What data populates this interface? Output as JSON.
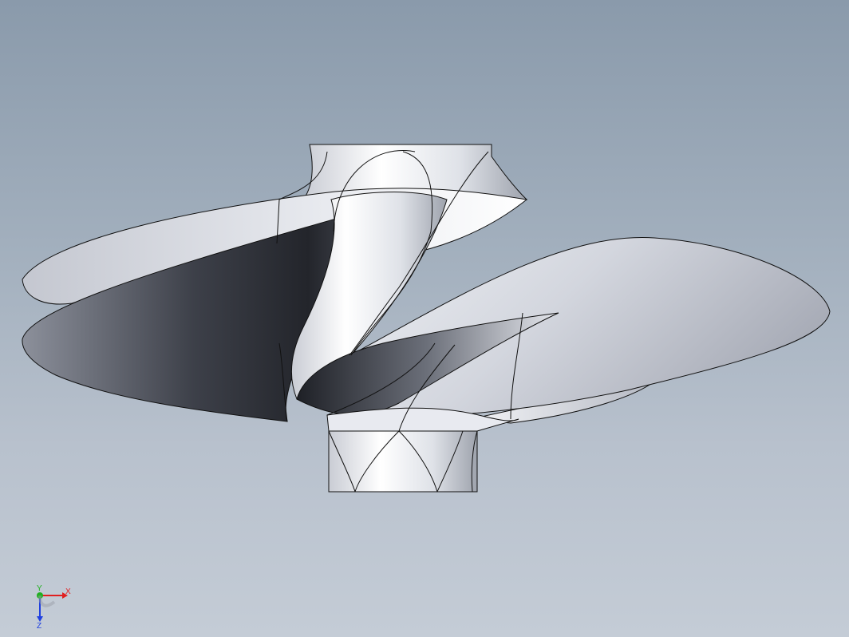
{
  "viewport": {
    "background_top": "#8a9aab",
    "background_bottom": "#c4ccd6"
  },
  "model": {
    "name": "mixed-flow-impeller",
    "blade_count": 3,
    "colors": {
      "metal_light": "#f4f5f8",
      "metal_mid": "#b9bcc6",
      "metal_dark": "#2a2c33",
      "edge": "#111111"
    }
  },
  "triad": {
    "x_label": "X",
    "y_label": "Y",
    "z_label": "Z",
    "x_color": "#e02020",
    "y_color": "#20b020",
    "z_color": "#2040e0"
  }
}
